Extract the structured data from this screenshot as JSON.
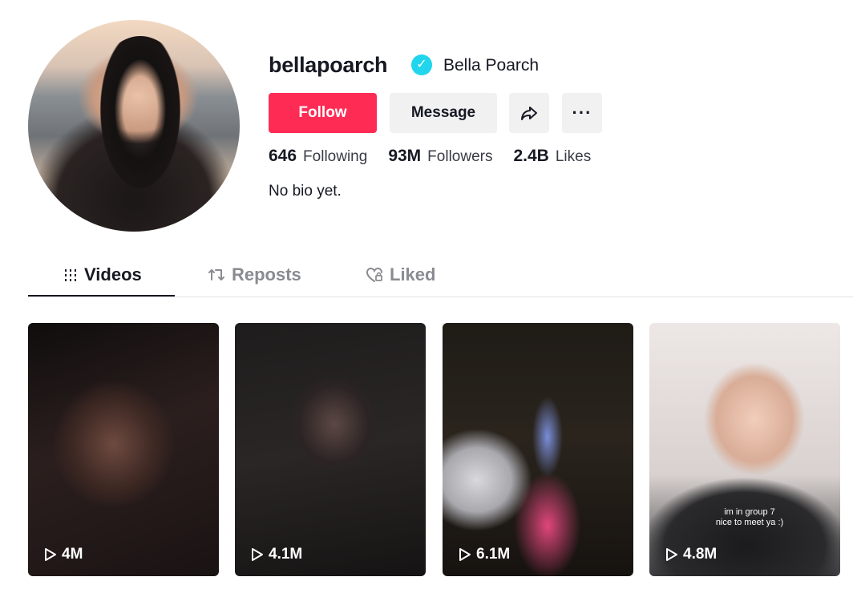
{
  "profile": {
    "username": "bellapoarch",
    "display_name": "Bella Poarch",
    "verified": true,
    "bio": "No bio yet."
  },
  "actions": {
    "follow_label": "Follow",
    "message_label": "Message"
  },
  "stats": {
    "following_count": "646",
    "following_label": "Following",
    "followers_count": "93M",
    "followers_label": "Followers",
    "likes_count": "2.4B",
    "likes_label": "Likes"
  },
  "tabs": [
    {
      "label": "Videos",
      "active": true
    },
    {
      "label": "Reposts",
      "active": false
    },
    {
      "label": "Liked",
      "active": false
    }
  ],
  "videos": [
    {
      "views": "4M"
    },
    {
      "views": "4.1M"
    },
    {
      "views": "6.1M"
    },
    {
      "views": "4.8M",
      "caption_line1": "im in group 7",
      "caption_line2": "nice to meet ya :)"
    }
  ],
  "colors": {
    "accent": "#fe2c55",
    "verified": "#20d5ec",
    "text": "#161823"
  }
}
